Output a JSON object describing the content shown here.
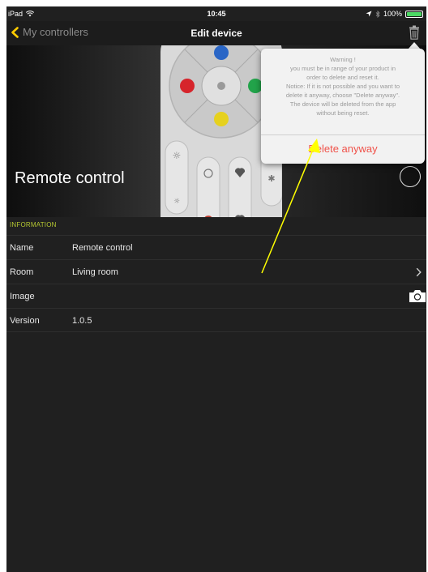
{
  "status_bar": {
    "device": "iPad",
    "time": "10:45",
    "battery": "100%",
    "battery_level": 1.0
  },
  "nav": {
    "back_label": "My controllers",
    "title": "Edit device"
  },
  "hero": {
    "title": "Remote control"
  },
  "popover": {
    "message_lines": [
      "Warning !",
      "you must be in range of your product in",
      "order to delete and reset it.",
      "Notice: If it is not possible and you want to",
      "delete it anyway, choose \"Delete anyway\".",
      "The device will be deleted from the app",
      "without being reset."
    ],
    "action_label": "Delete anyway",
    "action_color": "#f0524a"
  },
  "info": {
    "header": "INFORMATION",
    "header_color": "#b4c631",
    "rows": [
      {
        "label": "Name",
        "value": "Remote control"
      },
      {
        "label": "Room",
        "value": "Living room"
      },
      {
        "label": "Image",
        "value": ""
      },
      {
        "label": "Version",
        "value": "1.0.5"
      }
    ]
  },
  "icons": {
    "back": "chevron-left-icon",
    "trash": "trash-icon",
    "wifi": "wifi-icon",
    "location": "location-arrow-icon",
    "bluetooth": "bluetooth-icon",
    "battery": "battery-icon",
    "chevron": "chevron-right-icon",
    "camera": "camera-icon"
  },
  "colors": {
    "accent_back": "#8a8a8a",
    "annotation_arrow": "#ffff00",
    "battery_fill": "#4cd964"
  }
}
